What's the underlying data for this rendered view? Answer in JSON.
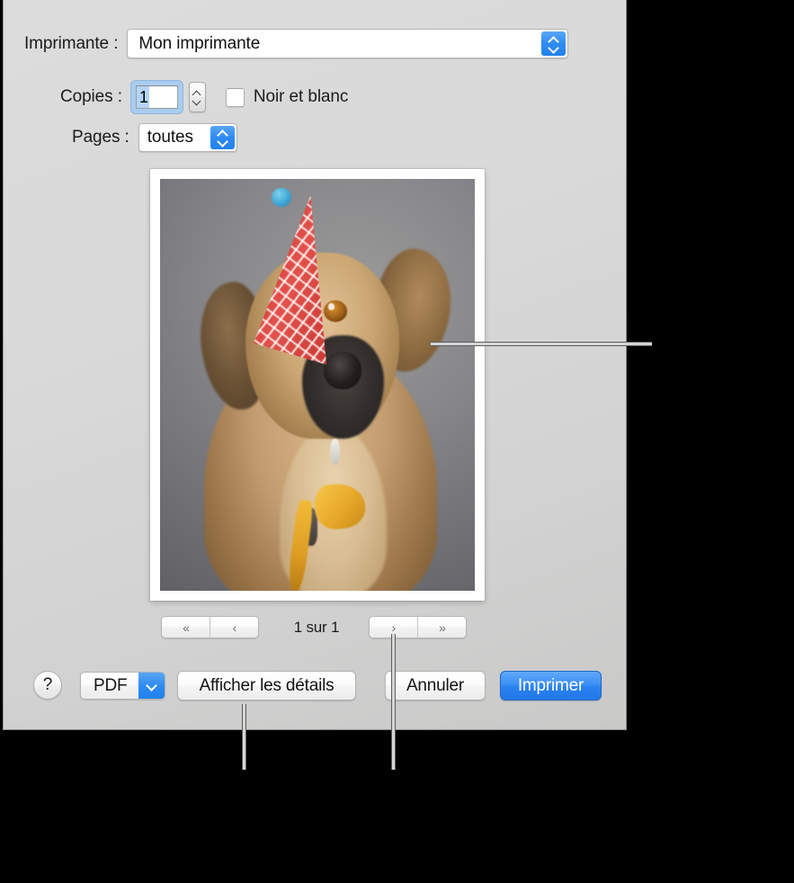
{
  "dialog": {
    "title": "Imprimer",
    "printer_row": {
      "label": "Imprimante :",
      "selected_value": "Mon imprimante",
      "stepper_icon": "chevron-up-down-icon"
    },
    "copies_row": {
      "label": "Copies :",
      "value": "1",
      "stepper_icon": "stepper-up-down-icon",
      "bw_checkbox_label": "Noir et blanc",
      "bw_checkbox_checked": false
    },
    "pages_row": {
      "label": "Pages :",
      "selected_value": "toutes",
      "stepper_icon": "chevron-up-down-icon"
    }
  },
  "preview": {
    "page_image_alt": "Chien avec chapeau de fête",
    "navigation": {
      "first_label": "«",
      "previous_label": "‹",
      "next_label": "›",
      "last_label": "»",
      "indicator": "1 sur 1"
    }
  },
  "bottom_bar": {
    "help_label": "?",
    "pdf_label": "PDF",
    "pdf_arrow_icon": "chevron-down-icon",
    "details_label": "Afficher les détails",
    "cancel_label": "Annuler",
    "print_label": "Imprimer"
  },
  "colors": {
    "accent_blue": "#2f8bf2",
    "print_button_blue": "#3b90f5",
    "dialog_background": "#d9d9d9",
    "callout_line": "#5e5e5e",
    "selection_blue": "#b4d5f5"
  }
}
